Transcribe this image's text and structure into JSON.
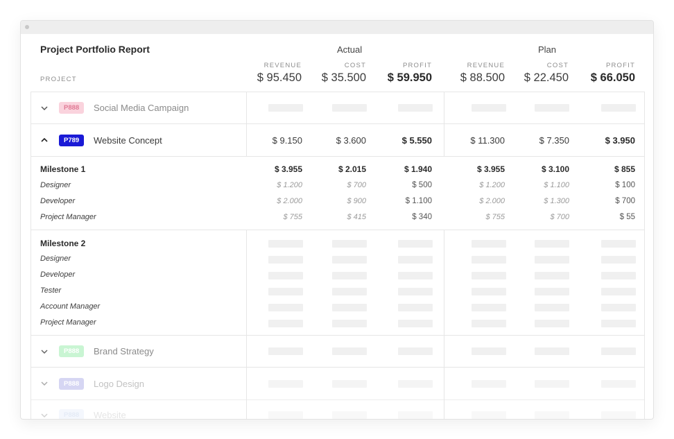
{
  "report": {
    "title": "Project Portfolio Report",
    "groups": {
      "actual": "Actual",
      "plan": "Plan"
    },
    "columns": {
      "project": "PROJECT",
      "revenue": "REVENUE",
      "cost": "COST",
      "profit": "PROFIT"
    },
    "totals": {
      "actual": {
        "revenue": "$ 95.450",
        "cost": "$ 35.500",
        "profit": "$ 59.950"
      },
      "plan": {
        "revenue": "$ 88.500",
        "cost": "$ 22.450",
        "profit": "$ 66.050"
      }
    }
  },
  "projects": [
    {
      "code": "P888",
      "name": "Social Media Campaign",
      "badge_bg": "#fad3dd",
      "badge_fg": "#e07b95",
      "name_color": "#8a8a8a",
      "expanded": false
    },
    {
      "code": "P789",
      "name": "Website Concept",
      "badge_bg": "#1a1ad6",
      "badge_fg": "#ffffff",
      "name_color": "#3a3a3a",
      "expanded": true,
      "actual": {
        "revenue": "$ 9.150",
        "cost": "$ 3.600",
        "profit": "$ 5.550"
      },
      "plan": {
        "revenue": "$ 11.300",
        "cost": "$ 7.350",
        "profit": "$ 3.950"
      }
    },
    {
      "code": "P888",
      "name": "Brand Strategy",
      "badge_bg": "#c9f5d3",
      "badge_fg": "#ffffff",
      "name_color": "#8a8a8a",
      "expanded": false
    },
    {
      "code": "P888",
      "name": "Logo Design",
      "badge_bg": "#c6c6ef",
      "badge_fg": "#ffffff",
      "name_color": "#a8a8a8",
      "expanded": false
    },
    {
      "code": "P888",
      "name": "Website",
      "badge_bg": "#e6eefb",
      "badge_fg": "#c5d2ea",
      "name_color": "#c6c6c6",
      "expanded": false
    }
  ],
  "milestone1": {
    "title": "Milestone 1",
    "totals": {
      "a_rev": "$ 3.955",
      "a_cost": "$ 2.015",
      "a_profit": "$ 1.940",
      "p_rev": "$ 3.955",
      "p_cost": "$ 3.100",
      "p_profit": "$ 855"
    },
    "roles": [
      {
        "name": "Designer",
        "a_rev": "$ 1.200",
        "a_cost": "$ 700",
        "a_profit": "$ 500",
        "p_rev": "$ 1.200",
        "p_cost": "$ 1.100",
        "p_profit": "$ 100"
      },
      {
        "name": "Developer",
        "a_rev": "$ 2.000",
        "a_cost": "$ 900",
        "a_profit": "$ 1.100",
        "p_rev": "$ 2.000",
        "p_cost": "$ 1.300",
        "p_profit": "$ 700"
      },
      {
        "name": "Project Manager",
        "a_rev": "$ 755",
        "a_cost": "$ 415",
        "a_profit": "$ 340",
        "p_rev": "$ 755",
        "p_cost": "$ 700",
        "p_profit": "$ 55"
      }
    ]
  },
  "milestone2": {
    "title": "Milestone 2",
    "roles": [
      "Designer",
      "Developer",
      "Tester",
      "Account Manager",
      "Project Manager"
    ]
  }
}
